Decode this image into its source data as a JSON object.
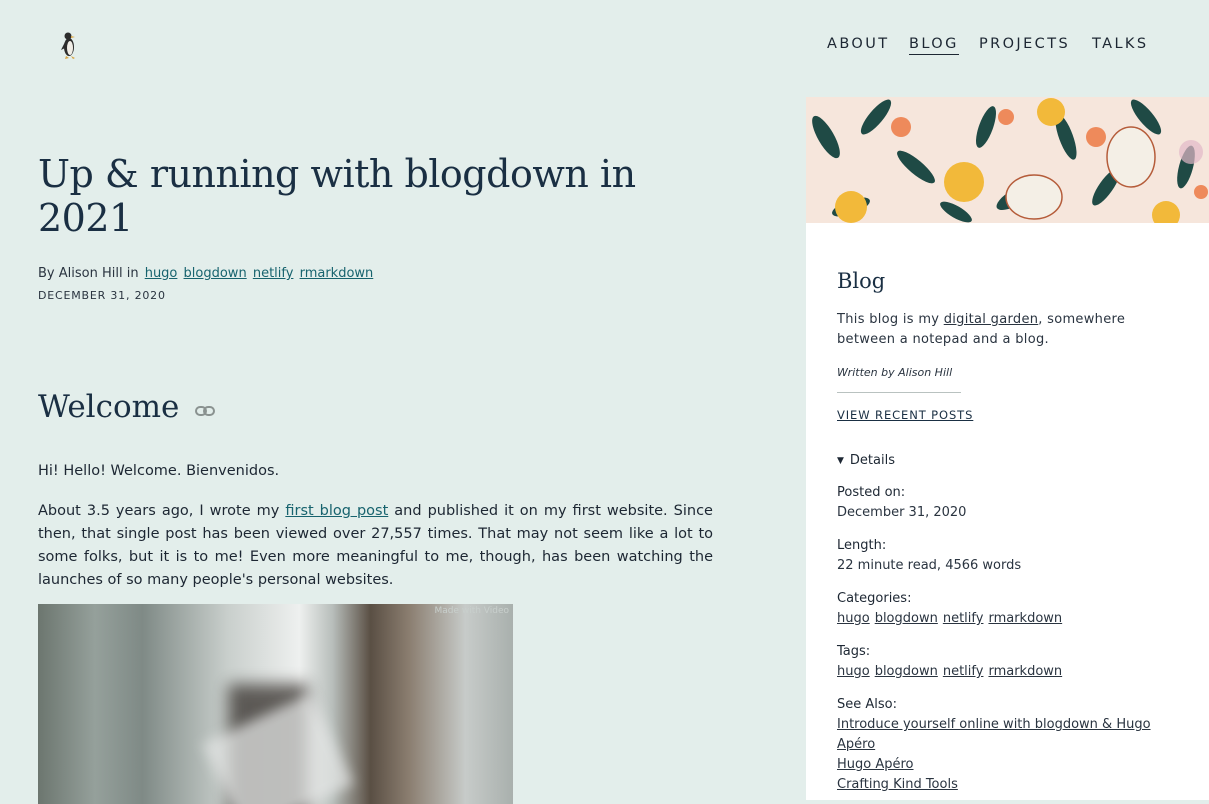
{
  "nav": {
    "items": [
      {
        "label": "ABOUT"
      },
      {
        "label": "BLOG"
      },
      {
        "label": "PROJECTS"
      },
      {
        "label": "TALKS"
      }
    ]
  },
  "post": {
    "title": "Up & running with blogdown in 2021",
    "byline_prefix": "By Alison Hill in",
    "tags": [
      "hugo",
      "blogdown",
      "netlify",
      "rmarkdown"
    ],
    "date": "DECEMBER 31, 2020",
    "heading": "Welcome",
    "para1": "Hi! Hello! Welcome. Bienvenidos.",
    "para2_before": "About 3.5 years ago, I wrote my ",
    "para2_link": "first blog post",
    "para2_after": " and published it on my first website. Since then, that single post has been viewed over 27,557 times. That may not seem like a lot to some folks, but it is to me! Even more meaningful to me, though, has been watching the launches of so many people's personal websites.",
    "gif_watermark": "Made with Video"
  },
  "sidebar": {
    "title": "Blog",
    "desc_before": "This blog is my ",
    "desc_link": "digital garden",
    "desc_after": ", somewhere between a notepad and a blog.",
    "written_by": "Written by Alison Hill",
    "recent_link": "VIEW RECENT POSTS",
    "details_label": "Details",
    "posted_on_label": "Posted on:",
    "posted_on_value": "December 31, 2020",
    "length_label": "Length:",
    "length_value": "22 minute read, 4566 words",
    "categories_label": "Categories:",
    "categories": [
      "hugo",
      "blogdown",
      "netlify",
      "rmarkdown"
    ],
    "tags_label": "Tags:",
    "tags": [
      "hugo",
      "blogdown",
      "netlify",
      "rmarkdown"
    ],
    "see_also_label": "See Also:",
    "see_also": [
      "Introduce yourself online with blogdown & Hugo Apéro",
      "Hugo Apéro",
      "Crafting Kind Tools"
    ]
  },
  "colors": {
    "page_bg": "#e3eeeb",
    "sidebar_bg": "#ffffff",
    "link": "#17636e",
    "heading": "#1a2f43"
  }
}
